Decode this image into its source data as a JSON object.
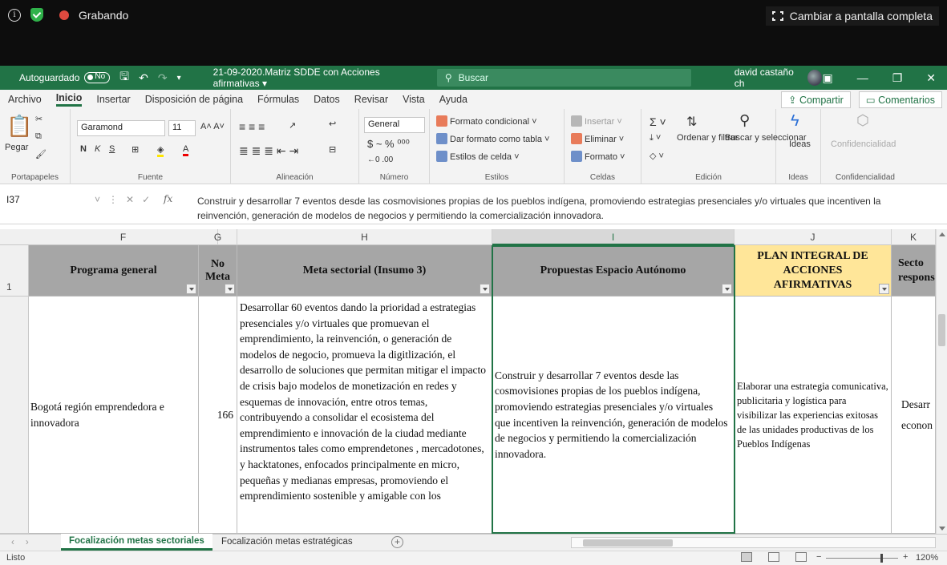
{
  "recorder": {
    "recording_label": "Grabando",
    "fullscreen_label": "Cambiar a pantalla completa"
  },
  "titlebar": {
    "autosave_label": "Autoguardado",
    "autosave_state": "No",
    "filename": "21-09-2020.Matriz SDDE con Acciones afirmativas",
    "search_placeholder": "Buscar",
    "user": "david castaño ch"
  },
  "ribbon_tabs": [
    "Archivo",
    "Inicio",
    "Insertar",
    "Disposición de página",
    "Fórmulas",
    "Datos",
    "Revisar",
    "Vista",
    "Ayuda"
  ],
  "ribbon_active_tab": "Inicio",
  "share_label": "Compartir",
  "comments_label": "Comentarios",
  "ribbon": {
    "paste": "Pegar",
    "clipboard_group": "Portapapeles",
    "font_name": "Garamond",
    "font_size": "11",
    "font_group": "Fuente",
    "alignment_group": "Alineación",
    "number_format": "General",
    "number_group": "Número",
    "cond_format": "Formato condicional",
    "table_format": "Dar formato como tabla",
    "cell_styles": "Estilos de celda",
    "styles_group": "Estilos",
    "insert": "Insertar",
    "delete": "Eliminar",
    "format": "Formato",
    "cells_group": "Celdas",
    "sort_filter": "Ordenar y filtrar",
    "find_select": "Buscar y seleccionar",
    "editing_group": "Edición",
    "ideas": "Ideas",
    "ideas_group": "Ideas",
    "sensitivity": "Confidencialidad",
    "sensitivity_group": "Confidencialidad"
  },
  "formula_bar": {
    "cell_ref": "I37",
    "content": "Construir y desarrollar 7 eventos desde las cosmovisiones propias de los pueblos indígena, promoviendo estrategias presenciales y/o virtuales que incentiven la reinvención, generación de modelos de negocios y permitiendo la comercialización innovadora."
  },
  "columns": [
    "F",
    "G",
    "H",
    "I",
    "J",
    "K"
  ],
  "rows": [
    "1"
  ],
  "headers": {
    "F": "Programa general",
    "G": "No Meta",
    "H": "Meta sectorial (Insumo 3)",
    "I": "Propuestas Espacio Autónomo",
    "J": "PLAN INTEGRAL DE ACCIONES AFIRMATIVAS",
    "K": "Secto respons"
  },
  "data_row": {
    "F": "Bogotá región emprendedora e innovadora",
    "G": "166",
    "H": "Desarrollar 60 eventos dando la prioridad a estrategias presenciales y/o virtuales que promuevan el emprendimiento, la reinvención, o generación de modelos de negocio, promueva la digitlización, el desarrollo de soluciones que permitan mitigar el impacto de crisis bajo modelos de monetización en redes y esquemas de innovación, entre otros temas, contribuyendo a consolidar el ecosistema del emprendimiento  e innovación de la ciudad mediante instrumentos tales como emprendetones , mercadotones, y hacktatones, enfocados principalmente en micro, pequeñas y medianas empresas, promoviendo el emprendimiento sostenible y amigable con los",
    "I": "Construir y desarrollar 7 eventos desde las cosmovisiones propias de los pueblos indígena, promoviendo estrategias presenciales y/o virtuales que incentiven la reinvención, generación de modelos de negocios y permitiendo la comercialización innovadora.",
    "J": "Elaborar una estrategia comunicativa, publicitaria y logística para visibilizar las experiencias exitosas de las unidades productivas de los Pueblos Indígenas",
    "K": "Desarr econon"
  },
  "sheets": [
    "Focalización metas sectoriales",
    "Focalización metas estratégicas"
  ],
  "active_sheet": "Focalización metas sectoriales",
  "status": {
    "ready": "Listo",
    "zoom": "120%"
  }
}
